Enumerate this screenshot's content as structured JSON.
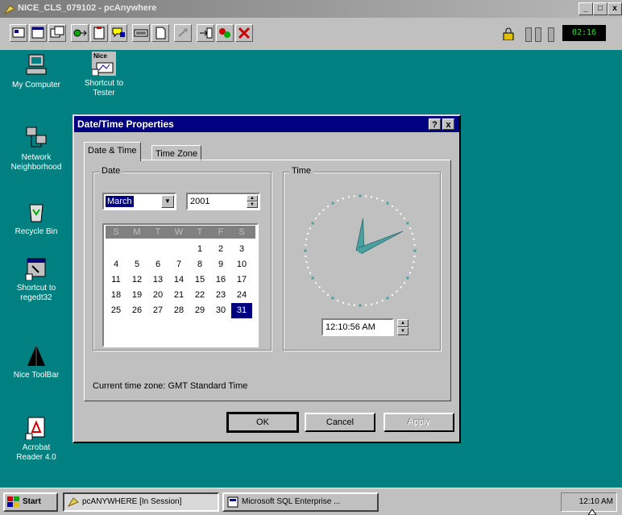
{
  "window": {
    "title": "NICE_CLS_079102 - pcAnywhere",
    "controls": {
      "minimize": "_",
      "maximize": "□",
      "close": "x"
    },
    "session_clock": "02:16"
  },
  "desktop": {
    "icons": [
      {
        "label": "My Computer"
      },
      {
        "label": "Shortcut to",
        "label2": "Tester",
        "badge": "Nice"
      },
      {
        "label": "Network",
        "label2": "Neighborhood"
      },
      {
        "label": "Recycle Bin"
      },
      {
        "label": "Shortcut to",
        "label2": "regedt32"
      },
      {
        "label": "Nice ToolBar"
      },
      {
        "label": "Acrobat",
        "label2": "Reader 4.0"
      }
    ]
  },
  "dialog": {
    "title": "Date/Time Properties",
    "help": "?",
    "close": "x",
    "tabs": [
      "Date & Time",
      "Time Zone"
    ],
    "date_group": "Date",
    "time_group": "Time",
    "month": "March",
    "year": "2001",
    "weekdays": [
      "S",
      "M",
      "T",
      "W",
      "T",
      "F",
      "S"
    ],
    "weeks": [
      [
        "",
        "",
        "",
        "",
        "1",
        "2",
        "3"
      ],
      [
        "4",
        "5",
        "6",
        "7",
        "8",
        "9",
        "10"
      ],
      [
        "11",
        "12",
        "13",
        "14",
        "15",
        "16",
        "17"
      ],
      [
        "18",
        "19",
        "20",
        "21",
        "22",
        "23",
        "24"
      ],
      [
        "25",
        "26",
        "27",
        "28",
        "29",
        "30",
        "31"
      ]
    ],
    "selected_day": "31",
    "time_value": "12:10:56 AM",
    "timezone_text": "Current time zone:  GMT Standard Time",
    "buttons": {
      "ok": "OK",
      "cancel": "Cancel",
      "apply": "Apply"
    }
  },
  "taskbar": {
    "start": "Start",
    "tasks": [
      "pcANYWHERE [In Session]",
      "Microsoft SQL Enterprise ..."
    ],
    "time": "12:10 AM"
  },
  "colors": {
    "desktop": "#008080",
    "title_active": "#000080",
    "selection": "#000080",
    "clock_hands": "#4aa0a0"
  }
}
